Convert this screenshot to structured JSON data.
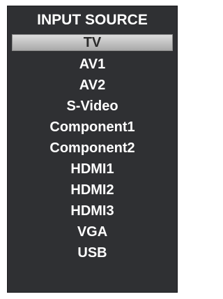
{
  "menu": {
    "title": "INPUT SOURCE",
    "selected_index": 0,
    "items": [
      {
        "label": "TV"
      },
      {
        "label": "AV1"
      },
      {
        "label": "AV2"
      },
      {
        "label": "S-Video"
      },
      {
        "label": "Component1"
      },
      {
        "label": "Component2"
      },
      {
        "label": "HDMI1"
      },
      {
        "label": "HDMI2"
      },
      {
        "label": "HDMI3"
      },
      {
        "label": "VGA"
      },
      {
        "label": "USB"
      }
    ]
  },
  "colors": {
    "panel_background": "#2f3033",
    "text": "#ffffff",
    "highlight": "#c0c0c0",
    "highlight_text": "#2b2b2b"
  }
}
